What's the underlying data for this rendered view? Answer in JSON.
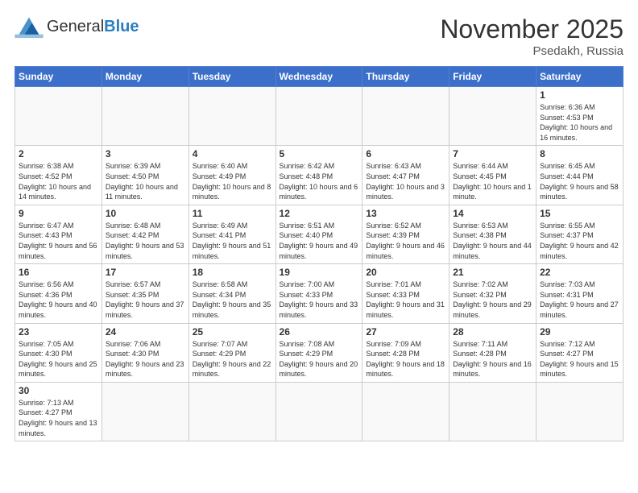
{
  "logo": {
    "text_general": "General",
    "text_blue": "Blue"
  },
  "title": "November 2025",
  "location": "Psedakh, Russia",
  "days": [
    "Sunday",
    "Monday",
    "Tuesday",
    "Wednesday",
    "Thursday",
    "Friday",
    "Saturday"
  ],
  "weeks": [
    [
      {
        "date": "",
        "info": ""
      },
      {
        "date": "",
        "info": ""
      },
      {
        "date": "",
        "info": ""
      },
      {
        "date": "",
        "info": ""
      },
      {
        "date": "",
        "info": ""
      },
      {
        "date": "",
        "info": ""
      },
      {
        "date": "1",
        "info": "Sunrise: 6:36 AM\nSunset: 4:53 PM\nDaylight: 10 hours and 16 minutes."
      }
    ],
    [
      {
        "date": "2",
        "info": "Sunrise: 6:38 AM\nSunset: 4:52 PM\nDaylight: 10 hours and 14 minutes."
      },
      {
        "date": "3",
        "info": "Sunrise: 6:39 AM\nSunset: 4:50 PM\nDaylight: 10 hours and 11 minutes."
      },
      {
        "date": "4",
        "info": "Sunrise: 6:40 AM\nSunset: 4:49 PM\nDaylight: 10 hours and 8 minutes."
      },
      {
        "date": "5",
        "info": "Sunrise: 6:42 AM\nSunset: 4:48 PM\nDaylight: 10 hours and 6 minutes."
      },
      {
        "date": "6",
        "info": "Sunrise: 6:43 AM\nSunset: 4:47 PM\nDaylight: 10 hours and 3 minutes."
      },
      {
        "date": "7",
        "info": "Sunrise: 6:44 AM\nSunset: 4:45 PM\nDaylight: 10 hours and 1 minute."
      },
      {
        "date": "8",
        "info": "Sunrise: 6:45 AM\nSunset: 4:44 PM\nDaylight: 9 hours and 58 minutes."
      }
    ],
    [
      {
        "date": "9",
        "info": "Sunrise: 6:47 AM\nSunset: 4:43 PM\nDaylight: 9 hours and 56 minutes."
      },
      {
        "date": "10",
        "info": "Sunrise: 6:48 AM\nSunset: 4:42 PM\nDaylight: 9 hours and 53 minutes."
      },
      {
        "date": "11",
        "info": "Sunrise: 6:49 AM\nSunset: 4:41 PM\nDaylight: 9 hours and 51 minutes."
      },
      {
        "date": "12",
        "info": "Sunrise: 6:51 AM\nSunset: 4:40 PM\nDaylight: 9 hours and 49 minutes."
      },
      {
        "date": "13",
        "info": "Sunrise: 6:52 AM\nSunset: 4:39 PM\nDaylight: 9 hours and 46 minutes."
      },
      {
        "date": "14",
        "info": "Sunrise: 6:53 AM\nSunset: 4:38 PM\nDaylight: 9 hours and 44 minutes."
      },
      {
        "date": "15",
        "info": "Sunrise: 6:55 AM\nSunset: 4:37 PM\nDaylight: 9 hours and 42 minutes."
      }
    ],
    [
      {
        "date": "16",
        "info": "Sunrise: 6:56 AM\nSunset: 4:36 PM\nDaylight: 9 hours and 40 minutes."
      },
      {
        "date": "17",
        "info": "Sunrise: 6:57 AM\nSunset: 4:35 PM\nDaylight: 9 hours and 37 minutes."
      },
      {
        "date": "18",
        "info": "Sunrise: 6:58 AM\nSunset: 4:34 PM\nDaylight: 9 hours and 35 minutes."
      },
      {
        "date": "19",
        "info": "Sunrise: 7:00 AM\nSunset: 4:33 PM\nDaylight: 9 hours and 33 minutes."
      },
      {
        "date": "20",
        "info": "Sunrise: 7:01 AM\nSunset: 4:33 PM\nDaylight: 9 hours and 31 minutes."
      },
      {
        "date": "21",
        "info": "Sunrise: 7:02 AM\nSunset: 4:32 PM\nDaylight: 9 hours and 29 minutes."
      },
      {
        "date": "22",
        "info": "Sunrise: 7:03 AM\nSunset: 4:31 PM\nDaylight: 9 hours and 27 minutes."
      }
    ],
    [
      {
        "date": "23",
        "info": "Sunrise: 7:05 AM\nSunset: 4:30 PM\nDaylight: 9 hours and 25 minutes."
      },
      {
        "date": "24",
        "info": "Sunrise: 7:06 AM\nSunset: 4:30 PM\nDaylight: 9 hours and 23 minutes."
      },
      {
        "date": "25",
        "info": "Sunrise: 7:07 AM\nSunset: 4:29 PM\nDaylight: 9 hours and 22 minutes."
      },
      {
        "date": "26",
        "info": "Sunrise: 7:08 AM\nSunset: 4:29 PM\nDaylight: 9 hours and 20 minutes."
      },
      {
        "date": "27",
        "info": "Sunrise: 7:09 AM\nSunset: 4:28 PM\nDaylight: 9 hours and 18 minutes."
      },
      {
        "date": "28",
        "info": "Sunrise: 7:11 AM\nSunset: 4:28 PM\nDaylight: 9 hours and 16 minutes."
      },
      {
        "date": "29",
        "info": "Sunrise: 7:12 AM\nSunset: 4:27 PM\nDaylight: 9 hours and 15 minutes."
      }
    ],
    [
      {
        "date": "30",
        "info": "Sunrise: 7:13 AM\nSunset: 4:27 PM\nDaylight: 9 hours and 13 minutes."
      },
      {
        "date": "",
        "info": ""
      },
      {
        "date": "",
        "info": ""
      },
      {
        "date": "",
        "info": ""
      },
      {
        "date": "",
        "info": ""
      },
      {
        "date": "",
        "info": ""
      },
      {
        "date": "",
        "info": ""
      }
    ]
  ]
}
